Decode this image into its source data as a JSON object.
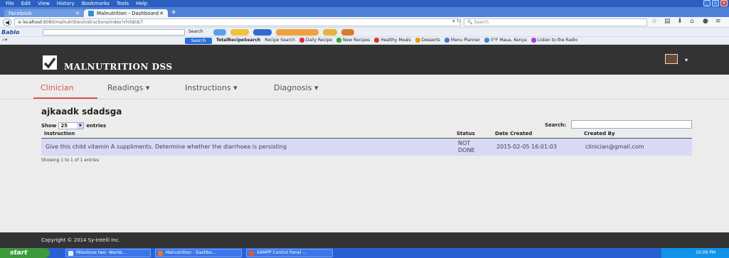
{
  "browser": {
    "menu": [
      "File",
      "Edit",
      "View",
      "History",
      "Bookmarks",
      "Tools",
      "Help"
    ],
    "tabs": [
      {
        "label": "Facebook",
        "active": false
      },
      {
        "label": "Malnutrition - Dashboard",
        "active": true
      }
    ],
    "url": {
      "host": "localhost",
      "path": ":8080/malnutrition/instructions/index?child/id/7"
    },
    "search_placeholder": "Search",
    "toolbar1": {
      "logo": "Bablo",
      "search_label": "Search"
    },
    "toolbar2": {
      "search_button": "Search",
      "brand": "TotalRecipeSearch",
      "items": [
        "Recipe Search",
        "Daily Recipe",
        "New Recipes",
        "Healthy Meals",
        "Desserts",
        "Menu Planner",
        "0°F Maua, Kenya",
        "Listen to the Radio"
      ]
    }
  },
  "app": {
    "brand": "MALNUTRITION DSS",
    "nav": [
      {
        "label": "Clinician",
        "active": true
      },
      {
        "label": "Readings",
        "dropdown": true
      },
      {
        "label": "Instructions",
        "dropdown": true
      },
      {
        "label": "Diagnosis",
        "dropdown": true
      }
    ],
    "page_title": "ajkaadk  sdadsga",
    "show_label": "Show",
    "entries_value": "25",
    "entries_label": "entries",
    "search_label": "Search:",
    "table": {
      "columns": [
        "Instruction",
        "Status",
        "Date Created",
        "Created By"
      ],
      "rows": [
        {
          "instruction": "Give this child vitamin A suppliments. Determine whether the diarrhoea is persisting",
          "status": "NOT DONE",
          "date_created": "2015-02-05 16:01:03",
          "created_by": "clinician@gmail.com"
        }
      ]
    },
    "info": "Showing 1 to 1 of 1 entries",
    "footer": "Copyright © 2014 Sy-Intelli Inc."
  },
  "taskbar": {
    "start": "start",
    "tasks": [
      "Milestone two- Wamb...",
      "Malnutrition - Dashbo...",
      "XAMPP Control Panel ..."
    ],
    "clock": "10:09 PM"
  },
  "colors": {
    "accent": "#d9534f",
    "header_bg": "#333333",
    "row_bg": "#d7d9f5"
  }
}
